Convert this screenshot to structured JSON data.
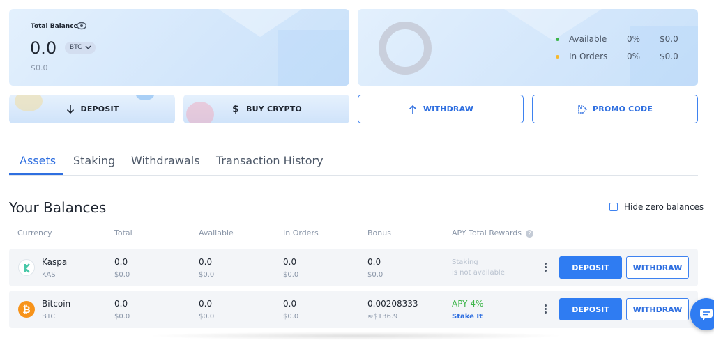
{
  "balance": {
    "label": "Total Balance",
    "value": "0.0",
    "currency": "BTC",
    "usd": "$0.0"
  },
  "legend": {
    "available": {
      "label": "Available",
      "pct": "0%",
      "amount": "$0.0",
      "color": "#3db54a"
    },
    "in_orders": {
      "label": "In Orders",
      "pct": "0%",
      "amount": "$0.0",
      "color": "#f5b82e"
    }
  },
  "actions": {
    "deposit": "DEPOSIT",
    "buy": "BUY CRYPTO",
    "withdraw": "WITHDRAW",
    "promo": "PROMO CODE"
  },
  "tabs": [
    {
      "label": "Assets",
      "active": true
    },
    {
      "label": "Staking",
      "active": false
    },
    {
      "label": "Withdrawals",
      "active": false
    },
    {
      "label": "Transaction History",
      "active": false
    }
  ],
  "balances": {
    "title": "Your Balances",
    "hide_zero_label": "Hide zero balances",
    "columns": [
      "Currency",
      "Total",
      "Available",
      "In Orders",
      "Bonus",
      "APY Total Rewards"
    ],
    "help_glyph": "?",
    "rows": [
      {
        "name": "Kaspa",
        "symbol": "KAS",
        "total": "0.0",
        "total_usd": "$0.0",
        "available": "0.0",
        "available_usd": "$0.0",
        "in_orders": "0.0",
        "in_orders_usd": "$0.0",
        "bonus": "0.0",
        "bonus_usd": "$0.0",
        "apy_line1": "Staking",
        "apy_line2": "is not available",
        "deposit_label": "DEPOSIT",
        "withdraw_label": "WITHDRAW"
      },
      {
        "name": "Bitcoin",
        "symbol": "BTC",
        "total": "0.0",
        "total_usd": "$0.0",
        "available": "0.0",
        "available_usd": "$0.0",
        "in_orders": "0.0",
        "in_orders_usd": "$0.0",
        "bonus": "0.00208333",
        "bonus_usd": "≈$136.9",
        "apy_line1": "APY 4%",
        "apy_line2": "Stake It",
        "deposit_label": "DEPOSIT",
        "withdraw_label": "WITHDRAW"
      }
    ]
  },
  "colors": {
    "accent": "#2f7cf2",
    "kaspa": "#49c8a8",
    "bitcoin": "#f7931a"
  }
}
